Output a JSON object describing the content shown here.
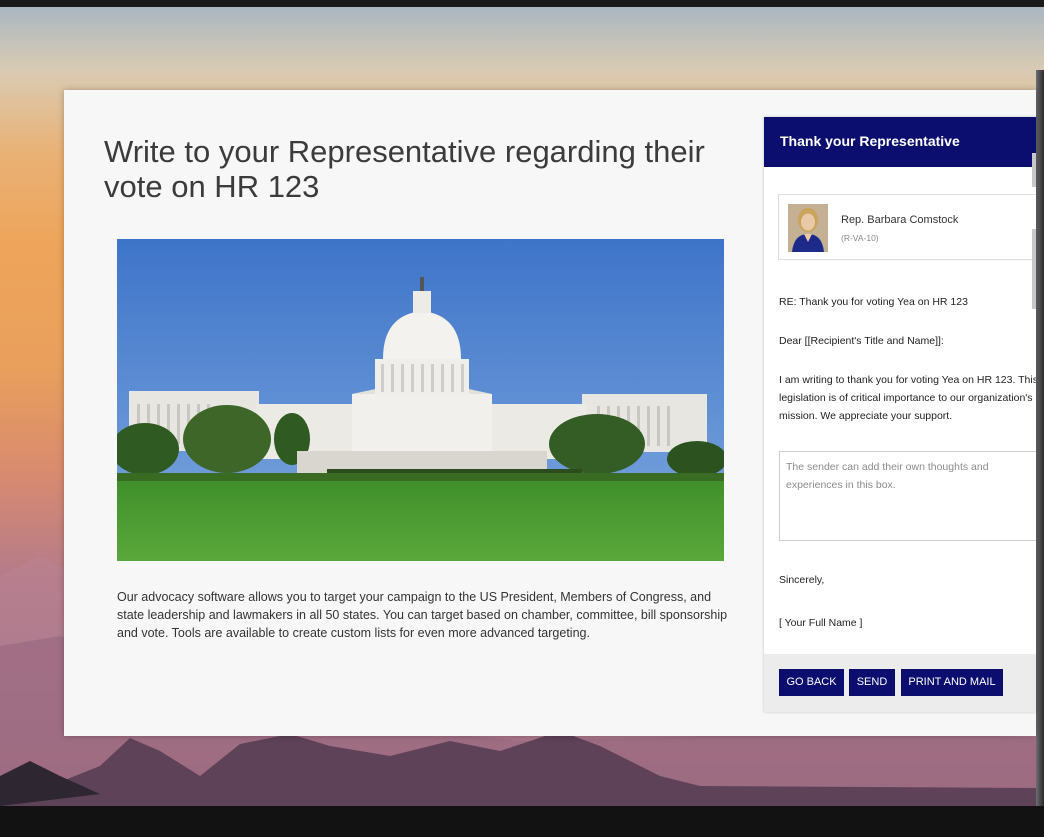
{
  "main": {
    "title": "Write to your Representative regarding their vote on HR 123",
    "description": "Our advocacy software allows you to target your campaign to the US President, Members of Congress, and state leadership and lawmakers in all 50 states. You can target based on chamber, committee, bill sponsorship and vote. Tools are available to create custom lists for even more advanced targeting."
  },
  "panel": {
    "title": "Thank your Representative",
    "rep": {
      "name": "Rep. Barbara Comstock",
      "district": "(R-VA-10)"
    },
    "subject": "RE: Thank you for voting Yea on HR 123",
    "greeting": "Dear [[Recipient's Title and Name]]:",
    "body": "I am writing to thank you for voting Yea on HR 123. This legislation is of critical importance to our organization's mission. We appreciate your support.",
    "thoughts_placeholder": "The sender can add their own thoughts and experiences in this box.",
    "closing": "Sincerely,",
    "signature": "[ Your Full Name ]",
    "buttons": {
      "back": "GO BACK",
      "send": "SEND",
      "print": "PRINT AND MAIL"
    }
  },
  "colors": {
    "header_bg": "#0c0e6f",
    "button_bg": "#0c0e6f"
  }
}
